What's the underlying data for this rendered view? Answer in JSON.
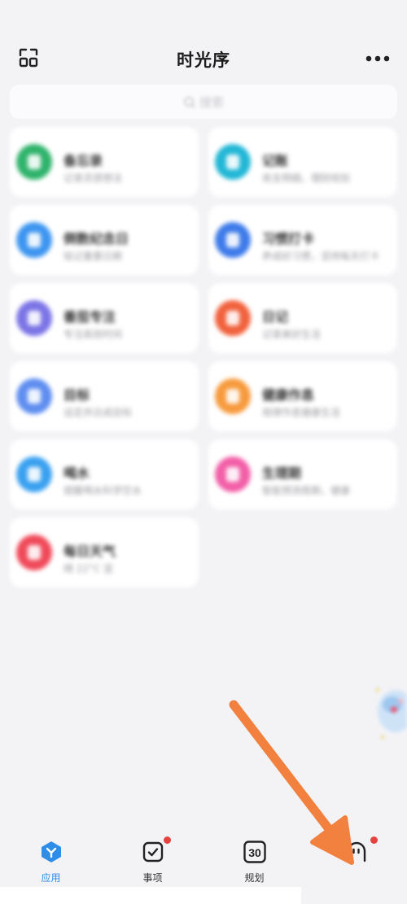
{
  "header": {
    "title": "时光序",
    "scan_icon": "scan-icon",
    "more_icon": "more-icon"
  },
  "search": {
    "placeholder": "搜索",
    "icon": "search-icon"
  },
  "apps": [
    {
      "name": "备忘录",
      "desc": "记录灵感想法",
      "color": "#2fb36b",
      "icon": "note-icon"
    },
    {
      "name": "记账",
      "desc": "收支明细，理财规划",
      "color": "#22b7d6",
      "icon": "wallet-icon"
    },
    {
      "name": "倒数纪念日",
      "desc": "铭记重要日期",
      "color": "#3d95f0",
      "icon": "calendar-icon"
    },
    {
      "name": "习惯打卡",
      "desc": "养成好习惯，坚持每天打卡",
      "color": "#3e7bea",
      "icon": "habit-icon"
    },
    {
      "name": "番茄专注",
      "desc": "专注高效时间",
      "color": "#7b74e6",
      "icon": "hourglass-icon"
    },
    {
      "name": "日记",
      "desc": "记录美好生活",
      "color": "#f1623d",
      "icon": "diary-icon"
    },
    {
      "name": "目标",
      "desc": "设定并达成目标",
      "color": "#5f8ef0",
      "icon": "target-icon"
    },
    {
      "name": "健康作息",
      "desc": "规律作息健康生活",
      "color": "#f79a3d",
      "icon": "health-icon"
    },
    {
      "name": "喝水",
      "desc": "提醒喝水科学饮水",
      "color": "#3aa1f0",
      "icon": "water-icon"
    },
    {
      "name": "生理期",
      "desc": "智能预测周期，健康",
      "color": "#f25fa8",
      "icon": "cycle-icon"
    },
    {
      "name": "每日天气",
      "desc": "晴 22°C 宜",
      "color": "#f04a5a",
      "icon": "weather-icon"
    }
  ],
  "tabs": [
    {
      "label": "应用",
      "icon": "apps-icon",
      "active": true,
      "badge": false
    },
    {
      "label": "事项",
      "icon": "todo-check-icon",
      "active": false,
      "badge": true
    },
    {
      "label": "规划",
      "icon": "calendar-30-icon",
      "active": false,
      "badge": false,
      "icon_text": "30"
    },
    {
      "label": "",
      "icon": "profile-face-icon",
      "active": false,
      "badge": true
    }
  ],
  "colors": {
    "accent": "#2f8dea",
    "badge": "#e8423f",
    "arrow": "#f2803e",
    "background": "#f3f3f6"
  }
}
